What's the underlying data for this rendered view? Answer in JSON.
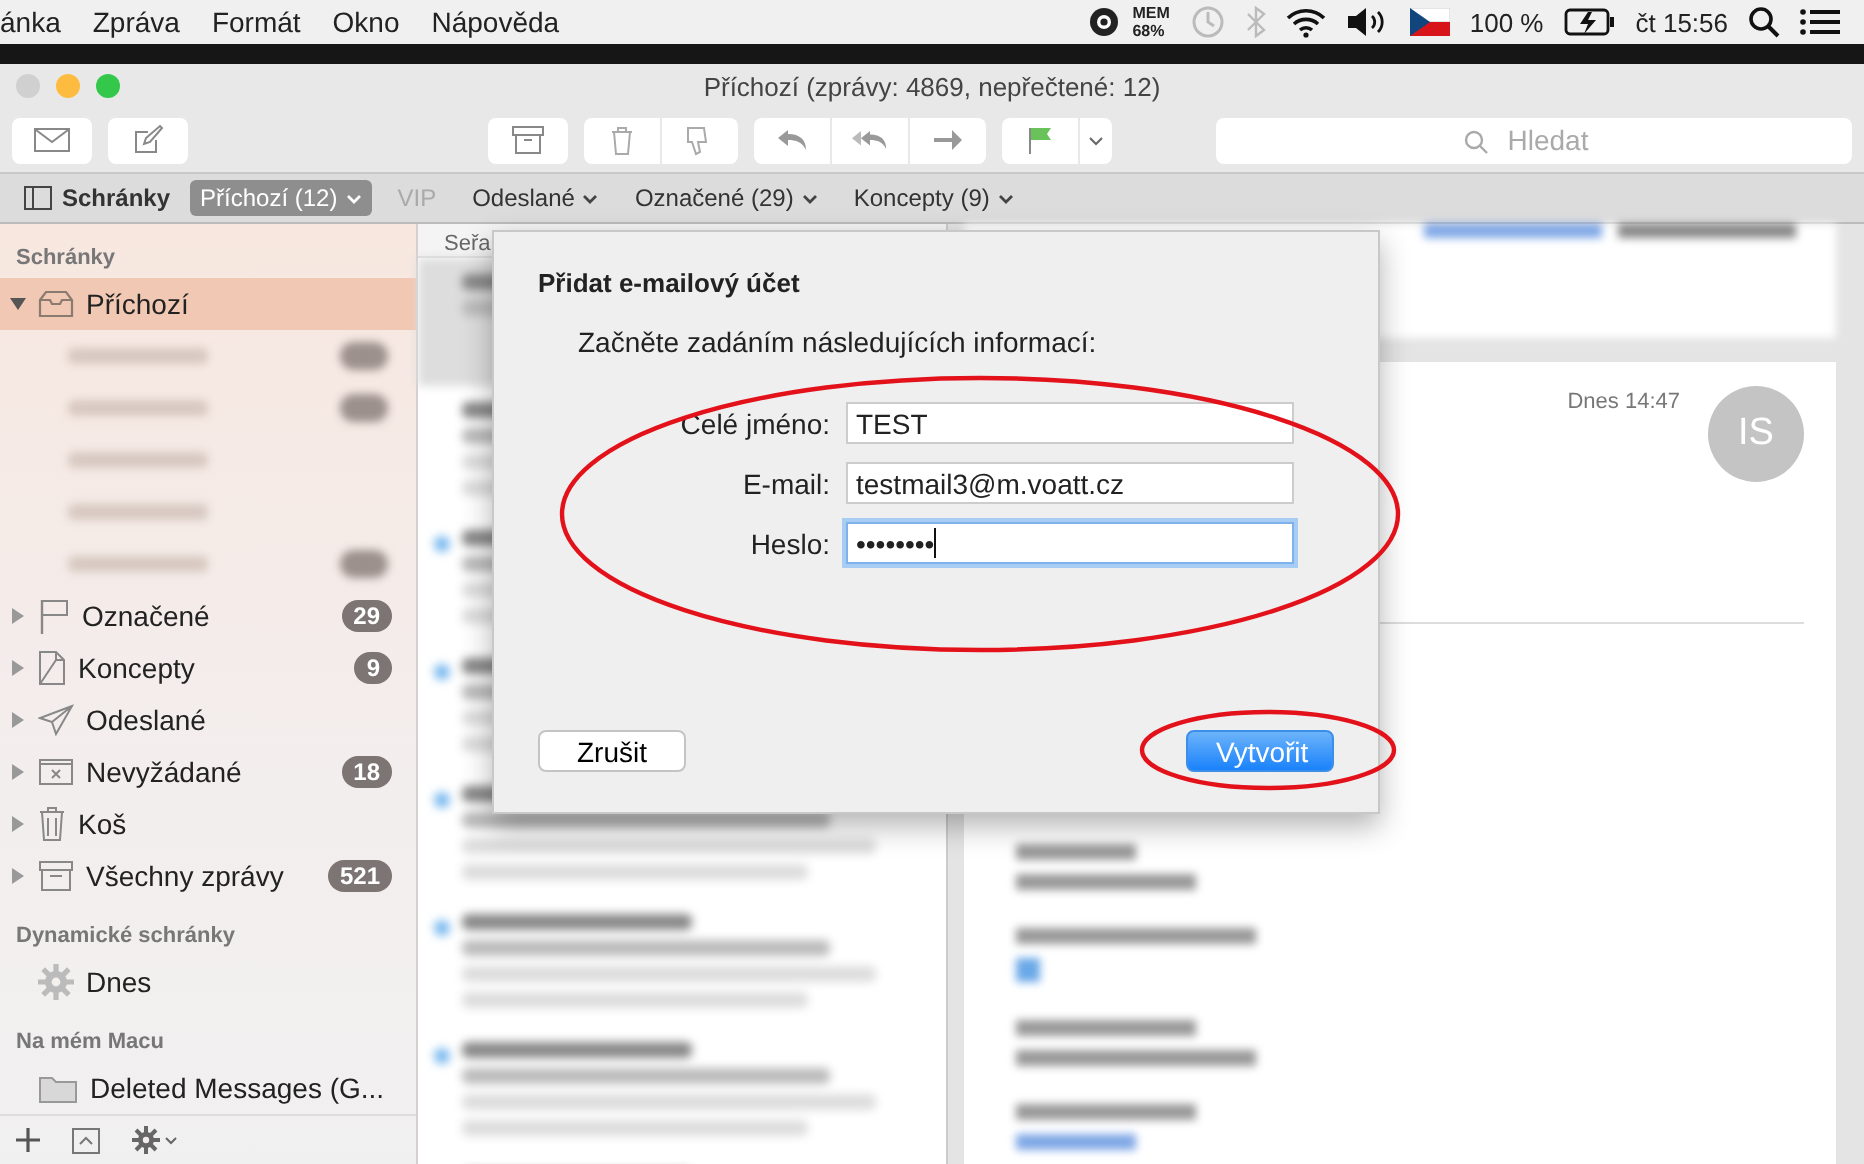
{
  "menubar": {
    "items": [
      "ánka",
      "Zpráva",
      "Formát",
      "Okno",
      "Nápověda"
    ],
    "mem_label": "MEM",
    "mem_value": "68%",
    "battery": "100 %",
    "clock": "čt 15:56"
  },
  "window": {
    "title": "Příchozí (zprávy: 4869, nepřečtené: 12)"
  },
  "toolbar": {
    "search": {
      "placeholder": "Hledat"
    }
  },
  "favorites_bar": {
    "mailboxes_toggle": "Schránky",
    "items": [
      {
        "label": "Příchozí (12)",
        "selected": true,
        "disabled": false
      },
      {
        "label": "VIP",
        "selected": false,
        "disabled": true
      },
      {
        "label": "Odeslané",
        "selected": false,
        "disabled": false
      },
      {
        "label": "Označené (29)",
        "selected": false,
        "disabled": false
      },
      {
        "label": "Koncepty (9)",
        "selected": false,
        "disabled": false
      }
    ]
  },
  "sidebar": {
    "sections": [
      {
        "title": "Schránky",
        "items": [
          {
            "label": "Příchozí",
            "expanded": true,
            "selected": true
          },
          {
            "label": "Označené",
            "expanded": false,
            "selected": false,
            "badge": "29"
          },
          {
            "label": "Koncepty",
            "expanded": false,
            "selected": false,
            "badge": "9"
          },
          {
            "label": "Odeslané",
            "expanded": false,
            "selected": false
          },
          {
            "label": "Nevyžádané",
            "expanded": false,
            "selected": false,
            "badge": "18"
          },
          {
            "label": "Koš",
            "expanded": false,
            "selected": false
          },
          {
            "label": "Všechny zprávy",
            "expanded": false,
            "selected": false,
            "badge": "521"
          }
        ]
      },
      {
        "title": "Dynamické schránky",
        "items": [
          {
            "label": "Dnes",
            "selected": false
          }
        ]
      },
      {
        "title": "Na mém Macu",
        "items": [
          {
            "label": "Deleted Messages (G...",
            "selected": false
          }
        ]
      }
    ]
  },
  "message_list": {
    "sort_label": "Seřa"
  },
  "viewer": {
    "date": "Dnes 14:47",
    "avatar_initials": "IS"
  },
  "dialog": {
    "title": "Přidat e-mailový účet",
    "intro": "Začněte zadáním následujících informací:",
    "fields": [
      {
        "label": "Celé jméno:",
        "value": "TEST",
        "focused": false
      },
      {
        "label": "E-mail:",
        "value": "testmail3@m.voatt.cz",
        "focused": false
      },
      {
        "label": "Heslo:",
        "value": "••••••••",
        "focused": true
      }
    ],
    "buttons": [
      {
        "label": "Zrušit",
        "kind": "cancel"
      },
      {
        "label": "Vytvořit",
        "kind": "default"
      }
    ]
  }
}
